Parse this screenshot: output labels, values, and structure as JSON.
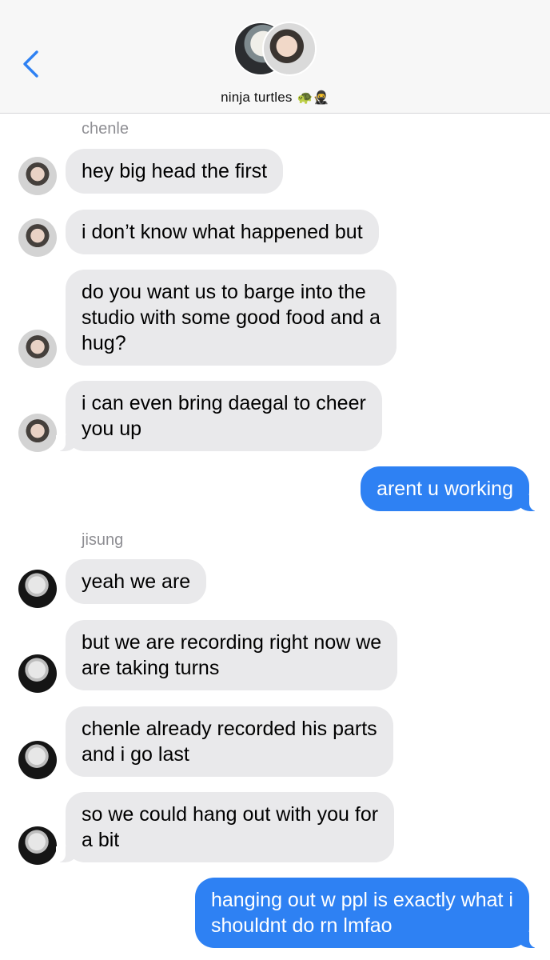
{
  "header": {
    "group_name": "ninja turtles",
    "group_emoji": "🐢🥷",
    "back_icon": "chevron-left-icon"
  },
  "colors": {
    "accent": "#2e81f3",
    "incoming_bubble": "#e9e9eb",
    "sender_label": "#8e8e93"
  },
  "senders": {
    "first": "chenle",
    "second": "jisung"
  },
  "messages": [
    {
      "from": "chenle",
      "text": "hey big head the first"
    },
    {
      "from": "chenle",
      "text": "i don’t know what happened but"
    },
    {
      "from": "chenle",
      "line1": "do you want us to barge into the",
      "line2": "studio with some good food and a",
      "line3": "hug?"
    },
    {
      "from": "chenle",
      "line1": "i can even bring daegal to cheer",
      "line2": "you up"
    },
    {
      "from": "me",
      "text": "arent u working"
    },
    {
      "from": "jisung",
      "text": "yeah we are"
    },
    {
      "from": "jisung",
      "line1": "but we are recording right now we",
      "line2": "are taking turns"
    },
    {
      "from": "jisung",
      "line1": "chenle already recorded his parts",
      "line2": "and i go last"
    },
    {
      "from": "jisung",
      "line1": "so we could hang out with you for",
      "line2": "a bit"
    },
    {
      "from": "me",
      "line1": "hanging out w ppl is exactly what i",
      "line2": "shouldnt do rn lmfao"
    }
  ]
}
